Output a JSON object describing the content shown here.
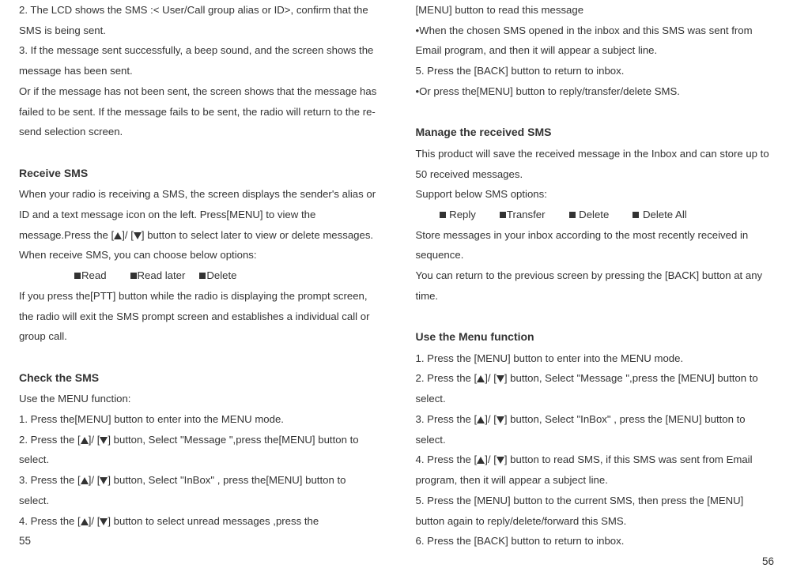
{
  "left": {
    "p1a": "2. The LCD shows the SMS :< User/Call group alias or ID>, confirm that the SMS is being sent.",
    "p1b": "3. If the message sent successfully, a beep sound, and the screen shows the message has been sent.",
    "p1c": "Or if the message has not been sent, the screen shows that the message has failed to be sent. If the message fails to be sent, the radio will return to the re-send selection screen.",
    "h1": "Receive SMS",
    "p2a_1": "When your radio is receiving a SMS, the screen displays the sender's alias or ID and a text message icon on the left. Press[MENU] to view the message.Press the [",
    "p2a_2": "]/ [",
    "p2a_3": "] button to select later to view or delete messages.",
    "p2b": "When receive SMS, you can choose below options:",
    "opt1": "Read",
    "opt2": "Read later",
    "opt3": "Delete",
    "p2c": " If you press the[PTT] button while the radio is displaying the prompt screen, the radio will exit the SMS prompt screen and establishes a individual call or group call.",
    "h2": "Check the SMS",
    "p3a": "Use the MENU function:",
    "p3b": "1.  Press the[MENU] button to enter into the MENU mode.",
    "p3c_1": "2.  Press the [",
    "p3c_2": "]/ [",
    "p3c_3": "] button, Select \"Message \",press the[MENU] button to select.",
    "p3d_1": "3.  Press the [",
    "p3d_2": "]/ [",
    "p3d_3": "] button, Select \"InBox\"  , press the[MENU] button to select.",
    "p3e_1": "4. Press the [",
    "p3e_2": "]/ [",
    "p3e_3": "] button to select unread messages ,press the",
    "pagenum": "55"
  },
  "right": {
    "p1a": "[MENU] button to read this message",
    "p1b": "•When the chosen SMS opened in the inbox and this SMS was sent from Email program, and then it will appear a subject line.",
    "p1c": "5. Press the [BACK] button to return to inbox.",
    "p1d": "•Or press the[MENU] button to reply/transfer/delete SMS.",
    "h1": "Manage the received SMS",
    "p2a": "This product will save the received message in the Inbox and can store up to 50 received messages.",
    "p2b": "Support below SMS options:",
    "opt1": "Reply",
    "opt2": "Transfer",
    "opt3": "Delete",
    "opt4": "Delete All",
    "p2c": "Store messages in your inbox according to the most recently received in sequence.",
    "p2d": "You can return to the previous screen by pressing the [BACK] button at any time.",
    "h2": "Use the Menu function",
    "p3a": "1.  Press the [MENU] button to enter into the MENU mode.",
    "p3b_1": "2.  Press the [",
    "p3b_2": "]/ [",
    "p3b_3": "] button, Select \"Message \",press the [MENU] button to select.",
    "p3c_1": "3.  Press the [",
    "p3c_2": "]/ [",
    "p3c_3": "] button, Select \"InBox\"  , press the [MENU] button to select.",
    "p3d_1": "4.  Press the [",
    "p3d_2": "]/ [",
    "p3d_3": "] button to read SMS, if this SMS was sent from Email program, then it will appear a subject line.",
    "p3e": "5.  Press the [MENU] button to the current SMS, then press the [MENU] button again to reply/delete/forward this SMS.",
    "p3f": "6.  Press the [BACK] button to return to inbox.",
    "pagenum": "56"
  }
}
